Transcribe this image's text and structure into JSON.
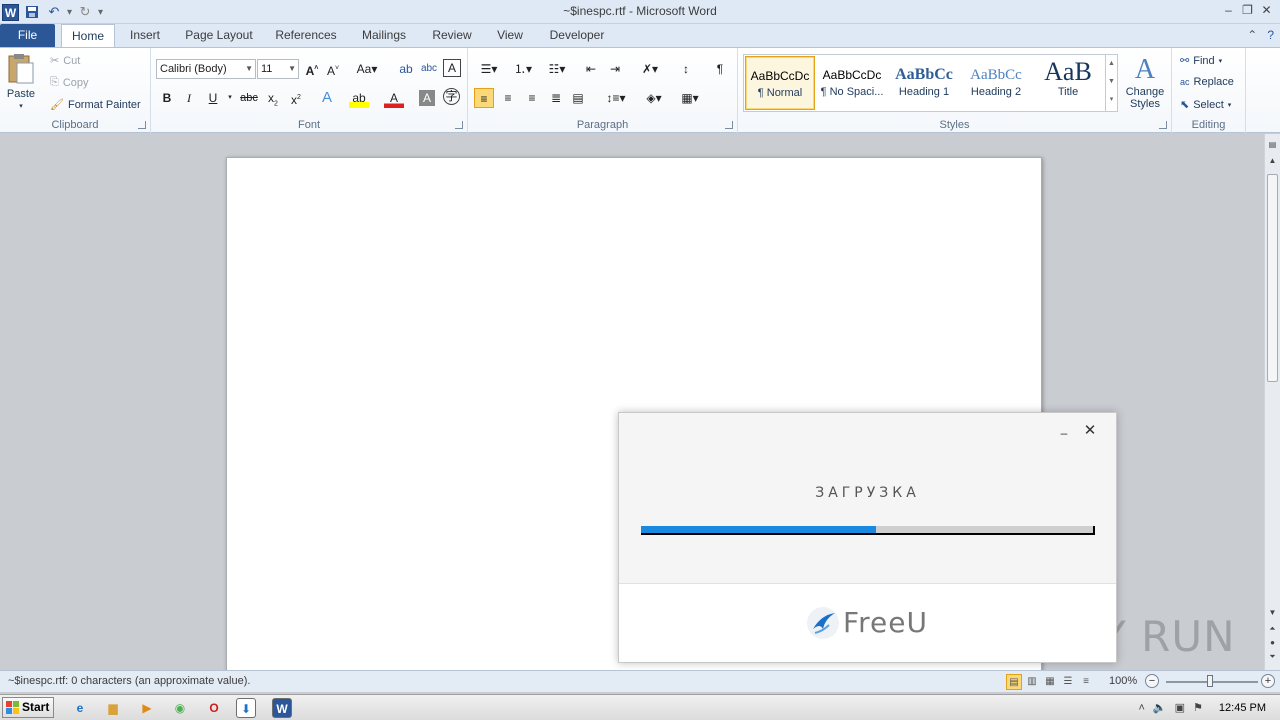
{
  "window": {
    "title": "~$inespc.rtf  -  Microsoft Word",
    "app_icon_letter": "W",
    "controls": [
      "–",
      "❐",
      "✕"
    ]
  },
  "tabs": {
    "file": "File",
    "items": [
      "Home",
      "Insert",
      "Page Layout",
      "References",
      "Mailings",
      "Review",
      "View",
      "Developer"
    ],
    "active": "Home"
  },
  "ribbon": {
    "clipboard": {
      "label": "Clipboard",
      "paste": "Paste",
      "cut": "Cut",
      "copy": "Copy",
      "format_painter": "Format Painter"
    },
    "font": {
      "label": "Font",
      "font_name": "Calibri (Body)",
      "font_size": "11"
    },
    "paragraph": {
      "label": "Paragraph"
    },
    "styles": {
      "label": "Styles",
      "items": [
        {
          "preview": "AaBbCcDc",
          "name": "¶ Normal"
        },
        {
          "preview": "AaBbCcDc",
          "name": "¶ No Spaci..."
        },
        {
          "preview": "AaBbCc",
          "name": "Heading 1"
        },
        {
          "preview": "AaBbCc",
          "name": "Heading 2"
        },
        {
          "preview": "AaB",
          "name": "Title"
        }
      ],
      "change_styles": "Change Styles"
    },
    "editing": {
      "label": "Editing",
      "find": "Find",
      "replace": "Replace",
      "select": "Select"
    }
  },
  "status": {
    "text": "~$inespc.rtf: 0 characters (an approximate value).",
    "zoom": "100%",
    "zoom_minus": "−",
    "zoom_plus": "+"
  },
  "dialog": {
    "title": "ЗАГРУЗКА",
    "progress": 0.52,
    "brand": "FreeU",
    "min_label": "–",
    "close_label": "✕"
  },
  "taskbar": {
    "start": "Start",
    "clock": "12:45 PM"
  },
  "watermark": "ANY RUN"
}
